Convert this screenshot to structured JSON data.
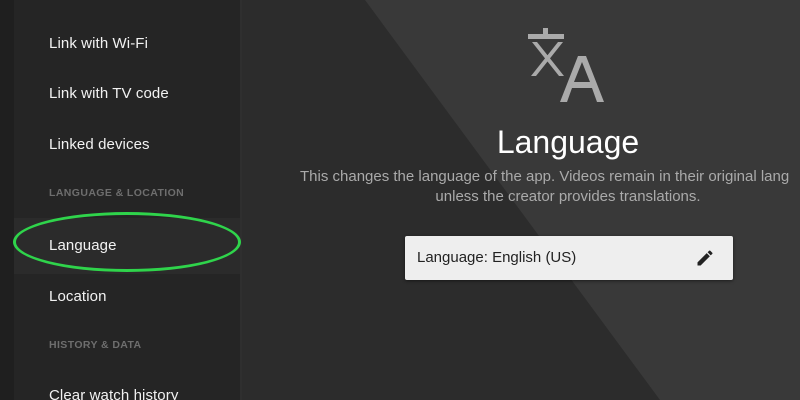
{
  "sidebar": {
    "items": [
      {
        "label": "Link with Wi-Fi"
      },
      {
        "label": "Link with TV code"
      },
      {
        "label": "Linked devices"
      },
      {
        "label": "Language"
      },
      {
        "label": "Location"
      },
      {
        "label": "Clear watch history"
      }
    ],
    "sections": [
      {
        "label": "LANGUAGE & LOCATION"
      },
      {
        "label": "HISTORY & DATA"
      }
    ],
    "selected": "Language",
    "highlight_color": "#2fd44b"
  },
  "main": {
    "icon": "translate-icon",
    "title": "Language",
    "description_line1": "This changes the language of the app. Videos remain in their original lang",
    "description_line2": "unless the creator provides translations.",
    "language_field": {
      "label": "Language: English (US)",
      "icon": "pencil-edit-icon"
    }
  }
}
